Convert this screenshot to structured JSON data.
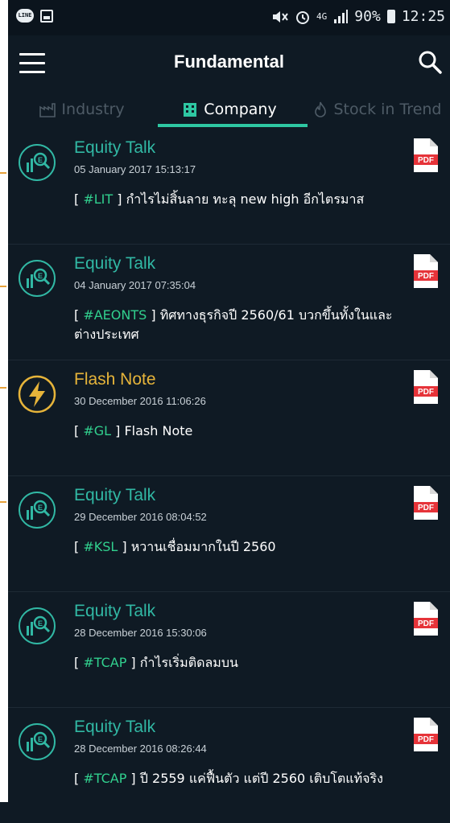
{
  "status_bar": {
    "left_icon_label": "LINE",
    "network": "4G",
    "battery": "90%",
    "time": "12:25"
  },
  "app_bar": {
    "title": "Fundamental"
  },
  "tabs": [
    {
      "label": "Industry",
      "icon": "factory-icon"
    },
    {
      "label": "Company",
      "icon": "building-icon"
    },
    {
      "label": "Stock in Trend",
      "icon": "flame-icon"
    }
  ],
  "active_tab": "Company",
  "colors": {
    "accent": "#2ec7a2",
    "equity_talk": "#31b8a4",
    "flash_note": "#e6b43a",
    "tag": "#31d08e",
    "pdf_red": "#e63339",
    "background": "#0f1a24"
  },
  "items": [
    {
      "type": "equity",
      "title": "Equity Talk",
      "date": "05 January 2017 15:13:17",
      "tag": "#LIT",
      "text": "กำไรไม่สิ้นลาย ทะลุ new high อีกไตรมาส",
      "pdf": "PDF"
    },
    {
      "type": "equity",
      "title": "Equity Talk",
      "date": "04 January 2017 07:35:04",
      "tag": "#AEONTS",
      "text": "ทิศทางธุรกิจปี 2560/61 บวกขึ้นทั้งในและต่างประเทศ",
      "pdf": "PDF"
    },
    {
      "type": "flash",
      "title": "Flash Note",
      "date": "30 December 2016 11:06:26",
      "tag": "#GL",
      "text": "Flash Note",
      "pdf": "PDF"
    },
    {
      "type": "equity",
      "title": "Equity Talk",
      "date": "29 December 2016 08:04:52",
      "tag": "#KSL",
      "text": "หวานเชื่อมมากในปี 2560",
      "pdf": "PDF"
    },
    {
      "type": "equity",
      "title": "Equity Talk",
      "date": "28 December 2016 15:30:06",
      "tag": "#TCAP",
      "text": "กำไรเริ่มติดลมบน",
      "pdf": "PDF"
    },
    {
      "type": "equity",
      "title": "Equity Talk",
      "date": "28 December 2016 08:26:44",
      "tag": "#TCAP",
      "text": "ปี 2559 แค่ฟื้นตัว แต่ปี 2560 เติบโตแท้จริง",
      "pdf": "PDF"
    }
  ]
}
